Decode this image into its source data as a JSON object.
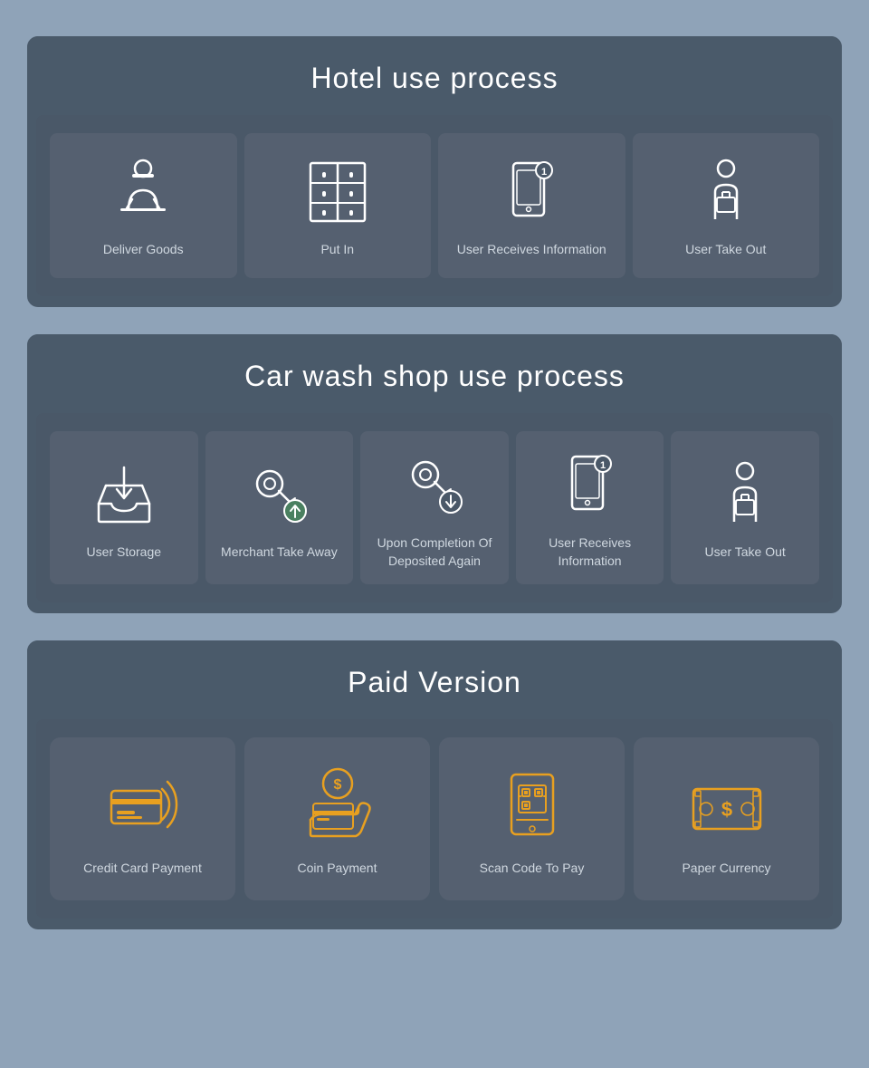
{
  "hotel_section": {
    "title": "Hotel use process",
    "items": [
      {
        "id": "deliver-goods",
        "label": "Deliver Goods",
        "icon": "delivery-person"
      },
      {
        "id": "put-in",
        "label": "Put In",
        "icon": "locker"
      },
      {
        "id": "user-receives-info",
        "label": "User Receives Information",
        "icon": "phone-notification"
      },
      {
        "id": "user-take-out",
        "label": "User Take Out",
        "icon": "person-box"
      }
    ]
  },
  "carwash_section": {
    "title": "Car wash shop use process",
    "items": [
      {
        "id": "user-storage",
        "label": "User Storage",
        "icon": "inbox-down"
      },
      {
        "id": "merchant-take-away",
        "label": "Merchant Take Away",
        "icon": "key-up"
      },
      {
        "id": "upon-completion",
        "label": "Upon Completion Of Deposited Again",
        "icon": "key-down"
      },
      {
        "id": "user-receives-info-2",
        "label": "User Receives Information",
        "icon": "phone-notification-2"
      },
      {
        "id": "user-take-out-2",
        "label": "User Take Out",
        "icon": "person-box-2"
      }
    ]
  },
  "paid_section": {
    "title": "Paid Version",
    "items": [
      {
        "id": "credit-card",
        "label": "Credit Card Payment",
        "icon": "credit-card"
      },
      {
        "id": "coin-payment",
        "label": "Coin Payment",
        "icon": "coin-payment"
      },
      {
        "id": "scan-code",
        "label": "Scan Code To Pay",
        "icon": "scan-code"
      },
      {
        "id": "paper-currency",
        "label": "Paper Currency",
        "icon": "paper-currency"
      }
    ]
  }
}
